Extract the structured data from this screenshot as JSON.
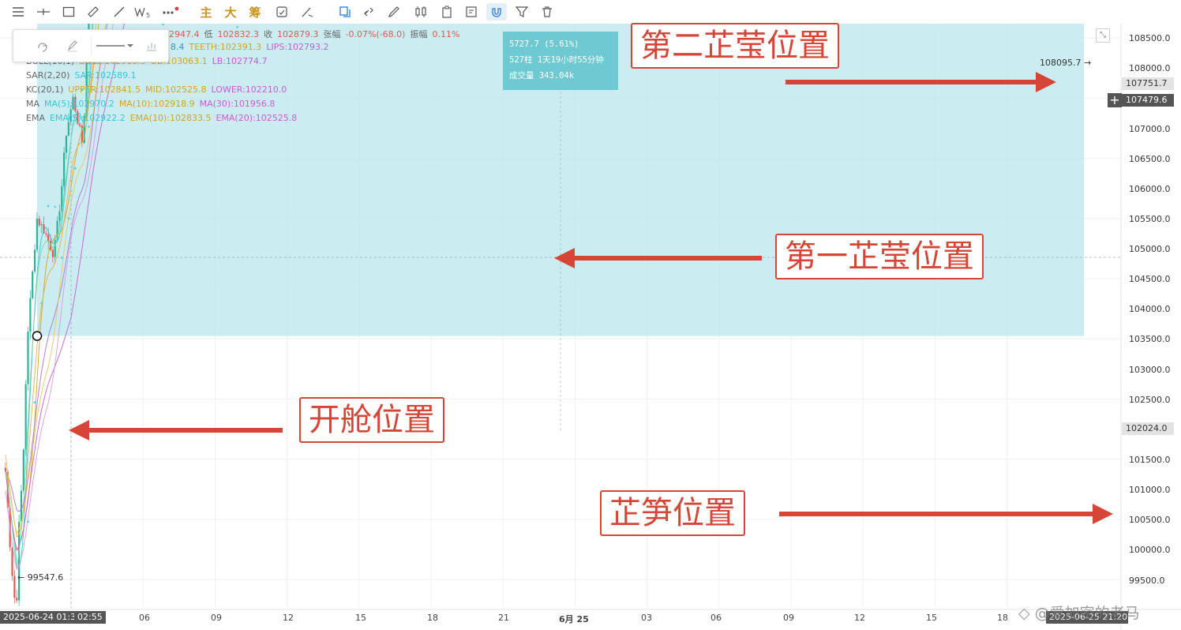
{
  "toolbar": {
    "zhu": "主",
    "da": "大",
    "chou": "筹"
  },
  "indicators": {
    "ohlc": {
      "high": "102947.4",
      "low_label": "低",
      "low": "102832.3",
      "close_label": "收",
      "close": "102879.3",
      "change_label": "张幅",
      "change": "-0.07%(-68.0)",
      "amp_label": "振幅",
      "amp": "0.11%"
    },
    "alligator": {
      "jaw_tail": "8.4",
      "teeth": "TEETH:102391.3",
      "lips": "LIPS:102793.2"
    },
    "boll": {
      "name": "BOLL(10,1)",
      "boll": "BOLL:102918.9",
      "ub": "UB:103063.1",
      "lb": "LB:102774.7"
    },
    "sar": {
      "name": "SAR(2,20)",
      "value": "SAR:102589.1"
    },
    "kc": {
      "name": "KC(20,1)",
      "upper": "UPPER:102841.5",
      "mid": "MID:102525.8",
      "lower": "LOWER:102210.0"
    },
    "ma": {
      "name": "MA",
      "ma5": "MA(5):102970.2",
      "ma10": "MA(10):102918.9",
      "ma30": "MA(30):101956.8"
    },
    "ema": {
      "name": "EMA",
      "ema5": "EMA(5):102922.2",
      "ema10": "EMA(10):102833.5",
      "ema20": "EMA(20):102525.8"
    }
  },
  "tooltip": {
    "line1": "5727.7 (5.61%)",
    "line2": "527柱 1天19小时55分钟",
    "line3": "成交量 343.04k"
  },
  "annotations": {
    "second_peak": "第二芷莹位置",
    "first_peak": "第一芷莹位置",
    "entry": "开舱位置",
    "low": "芷笋位置"
  },
  "markers": {
    "high_label": "108095.7",
    "low_label": "99547.6"
  },
  "price_axis": {
    "labels": [
      "108500.0",
      "108000.0",
      "107000.0",
      "106500.0",
      "106000.0",
      "105500.0",
      "105000.0",
      "104500.0",
      "104000.0",
      "103500.0",
      "103000.0",
      "102500.0",
      "101500.0",
      "101000.0",
      "100500.0",
      "100000.0",
      "99500.0"
    ],
    "tag_top": "107751.7",
    "tag_current": "107479.6",
    "tag_entry": "102024.0"
  },
  "time_axis": {
    "start_tag": "2025-06-24 01:30",
    "cursor_tag": "02:55",
    "labels": [
      "06",
      "09",
      "12",
      "15",
      "18",
      "21",
      "6月 25",
      "03",
      "06",
      "09",
      "12",
      "15",
      "18"
    ],
    "end_tag": "2025-06-25 21:20"
  },
  "watermark": "@爱加密的老马",
  "chart_data": {
    "type": "line",
    "title": "",
    "xlabel": "",
    "ylabel": "",
    "x": [
      "2025-06-24 01:30",
      "06",
      "09",
      "12",
      "15",
      "18",
      "21",
      "6月 25",
      "03",
      "06",
      "09",
      "12",
      "15",
      "18",
      "2025-06-25 21:20"
    ],
    "ylim": [
      99300,
      108800
    ],
    "price_anchors": {
      "x_hours": [
        0,
        0.15,
        0.3,
        0.45,
        0.55,
        0.7,
        0.9,
        1.1,
        1.3,
        1.6,
        2,
        2.3,
        2.5,
        2.8,
        3.2,
        3.6,
        4,
        4.3,
        4.6,
        4.9,
        5.1,
        5.4,
        5.8,
        6.1,
        6.4,
        6.6,
        6.9,
        7.3,
        8,
        9,
        10,
        11,
        12,
        12.6,
        13,
        13.4,
        14,
        14.5,
        15,
        15.4,
        15.8,
        16.5,
        17.5,
        18.5,
        19.5,
        20.5,
        21.2,
        22,
        22.7,
        23.2,
        23.7,
        24,
        24.4,
        24.8,
        25,
        25.4,
        25.8,
        26,
        26.3,
        26.8,
        27.2,
        27.6,
        28,
        28.5,
        29,
        29.5,
        30,
        30.5,
        31,
        31.4,
        31.8,
        32.3,
        33,
        33.5,
        34,
        34.5,
        35,
        35.5,
        36,
        36.5,
        37,
        37.5,
        38,
        38.5,
        39,
        39.5,
        40,
        40.5,
        41,
        41.3,
        41.6,
        41.9,
        42.2,
        42.5,
        42.8,
        43.1,
        43.4,
        43.7
      ],
      "close": [
        100900,
        100400,
        100000,
        99700,
        100500,
        100800,
        102000,
        102500,
        103000,
        102900,
        102700,
        103200,
        103700,
        104000,
        103600,
        105400,
        105600,
        105400,
        105300,
        105100,
        104900,
        105000,
        104900,
        104800,
        104850,
        104900,
        105100,
        105500,
        105300,
        104700,
        105100,
        105200,
        105100,
        105150,
        105000,
        104850,
        105000,
        105300,
        105500,
        105400,
        105250,
        105700,
        106200,
        105600,
        105500,
        105700,
        105800,
        106000,
        106100,
        106250,
        106400,
        106300,
        106700,
        106550,
        106450,
        106300,
        106200,
        106250,
        106300,
        106550,
        106600,
        106700,
        107000,
        107100,
        107200,
        107300,
        107400,
        107900,
        108050,
        107600,
        107500,
        107480,
        107200,
        107300,
        107400,
        107500,
        107450,
        107350,
        107400,
        107600,
        107700,
        107800,
        107750,
        107600,
        107550,
        107650,
        107700,
        107750,
        107800,
        107650,
        107700,
        107800,
        107750,
        107700,
        107480,
        107600,
        107500,
        107480
      ]
    },
    "series": [
      {
        "name": "MA(5)",
        "values_ref": "close"
      },
      {
        "name": "MA(10)",
        "values_ref": "close"
      },
      {
        "name": "MA(30)",
        "values_ref": "close"
      },
      {
        "name": "EMA(5)",
        "values_ref": "close"
      },
      {
        "name": "EMA(10)",
        "values_ref": "close"
      },
      {
        "name": "EMA(20)",
        "values_ref": "close"
      }
    ],
    "range_box": {
      "from_time": "2025-06-24 01:30",
      "to_time": "2025-06-25 18:30",
      "low": 102024.0,
      "high": 107751.7,
      "change": 5727.7,
      "change_pct": "5.61%"
    },
    "extremes": {
      "high": 108095.7,
      "low": 99547.6,
      "entry": 102024.0
    },
    "grid": true,
    "legend": "top-left",
    "colors": {
      "up": "#2bb39a",
      "down": "#e05a52",
      "box": "#b9e7ec",
      "annotation": "#d64535",
      "sar": "#5ad4e6"
    }
  }
}
